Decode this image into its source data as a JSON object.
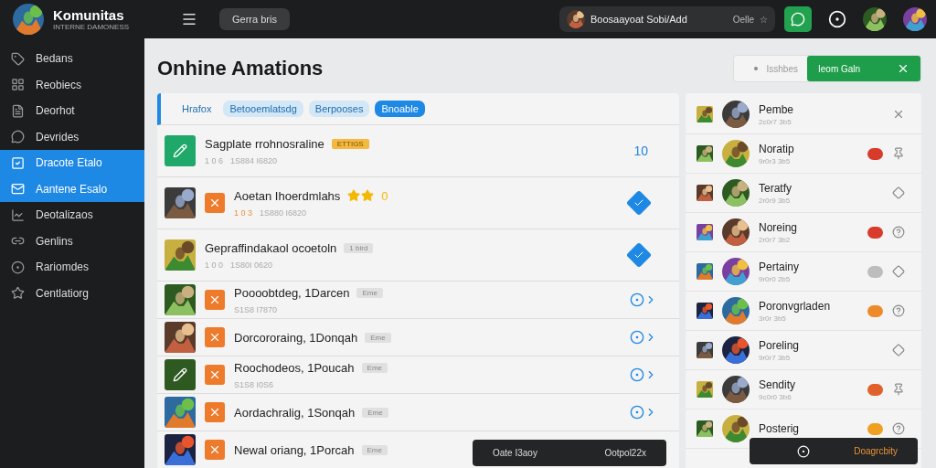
{
  "brand": {
    "name": "Komunitas",
    "tagline": "INTERNE DAMONESS"
  },
  "topbar": {
    "pill": "Gerra bris",
    "search": {
      "value": "Boosaayoat Sobi/Add",
      "hint": "Oelle",
      "star": "☆"
    }
  },
  "sidebar": {
    "items": [
      {
        "label": "Bedans",
        "selected": false
      },
      {
        "label": "Reobiecs",
        "selected": false
      },
      {
        "label": "Deorhot",
        "selected": false
      },
      {
        "label": "Devrides",
        "selected": false
      },
      {
        "label": "Dracote Etalo",
        "selected": true
      },
      {
        "label": "Aantene Esalo",
        "selected": true
      },
      {
        "label": "Deotalizaos",
        "selected": false
      },
      {
        "label": "Genlins",
        "selected": false
      },
      {
        "label": "Rariomdes",
        "selected": false
      },
      {
        "label": "Centlatiorg",
        "selected": false
      }
    ]
  },
  "page": {
    "title": "Onhine Amations"
  },
  "filters": {
    "text": "Isshbes",
    "active": "Ieom Galn"
  },
  "tabs": [
    {
      "label": "Hrafox",
      "selected": false
    },
    {
      "label": "Betooemlatsdg",
      "selected": false
    },
    {
      "label": "Berpooses",
      "selected": false
    },
    {
      "label": "Bnoable",
      "selected": true
    }
  ],
  "list": [
    {
      "kind": "featured",
      "title": "Sagplate rrohnosraline",
      "tag": "ETTIGS",
      "meta_a": "1 0 6",
      "meta_b": "1S884 I6820",
      "count": "10"
    },
    {
      "kind": "rated",
      "title": "Aoetan Ihoerdmlahs",
      "star_text": "0",
      "meta_a": "1 0 3",
      "meta_b": "1S880 I6820"
    },
    {
      "kind": "tagged",
      "title": "Gepraffindakaol ocoetoln",
      "tag": "1 bird",
      "meta_a": "1 0 0",
      "meta_b": "1S80I 0620"
    },
    {
      "kind": "compact",
      "title": "Poooobtdeg, 1Darcen",
      "tag": "Eme",
      "meta_b": "S1S8 I7870"
    },
    {
      "kind": "compact",
      "title": "Dorcororaing, 1Donqah",
      "tag": "Eme"
    },
    {
      "kind": "compact",
      "title": "Roochodeos, 1Poucah",
      "tag": "Eme",
      "meta_b": "S1S8 I0S6"
    },
    {
      "kind": "compact",
      "title": "Aordachralig, 1Sonqah",
      "tag": "Eme"
    },
    {
      "kind": "compact",
      "title": "Newal oriang, 1Porcah",
      "tag": "Eme"
    }
  ],
  "people": [
    {
      "name": "Pembe",
      "sub": "2c0r7 3b5"
    },
    {
      "name": "Noratip",
      "sub": "9r0r3 3b5",
      "color": "#d83b2b"
    },
    {
      "name": "Teratfy",
      "sub": "2r0r9 3b5"
    },
    {
      "name": "Noreing",
      "sub": "2r0r7 3b2",
      "color": "#d83b2b"
    },
    {
      "name": "Pertainy",
      "sub": "9r0r0 2b5",
      "color": "#bdbdbd"
    },
    {
      "name": "Poronvgrladen",
      "sub": "3r0r 3b5",
      "color": "#ef8a2a"
    },
    {
      "name": "Poreling",
      "sub": "9r0r7 3b5"
    },
    {
      "name": "Sendity",
      "sub": "9c0r0 3b6",
      "color": "#e0622a"
    },
    {
      "name": "Posterig",
      "color": "#f0a020"
    }
  ],
  "toasts": [
    {
      "left": "Oate I3aoy",
      "right": "Ootpol22x"
    },
    {
      "right": "Doagrcbity"
    }
  ]
}
